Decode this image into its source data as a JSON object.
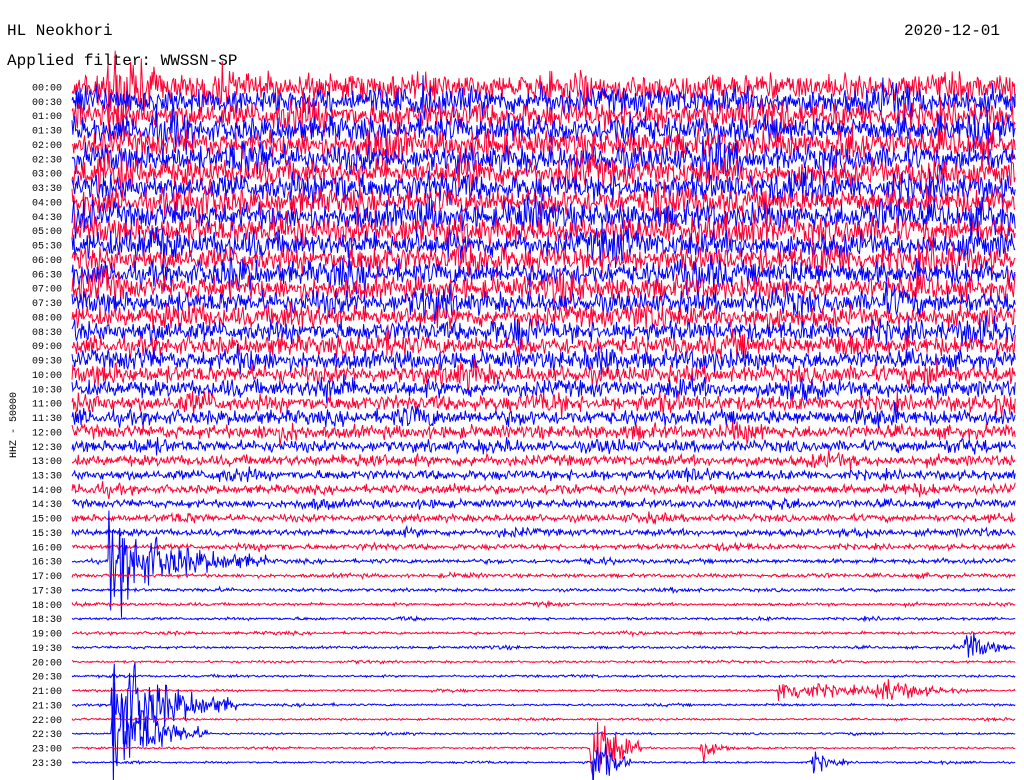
{
  "header": {
    "station": "HL Neokhori",
    "date": "2020-12-01",
    "filter": "Applied filter: WWSSN-SP"
  },
  "chart_data": {
    "type": "line",
    "title": "HL Neokhori",
    "date": "2020-12-01",
    "filter_label": "Applied filter: WWSSN-SP",
    "ylabel": "HHZ - 50000",
    "row_labels": [
      "00:00",
      "00:30",
      "01:00",
      "01:30",
      "02:00",
      "02:30",
      "03:00",
      "03:30",
      "04:00",
      "04:30",
      "05:00",
      "05:30",
      "06:00",
      "06:30",
      "07:00",
      "07:30",
      "08:00",
      "08:30",
      "09:00",
      "09:30",
      "10:00",
      "10:30",
      "11:00",
      "11:30",
      "12:00",
      "12:30",
      "13:00",
      "13:30",
      "14:00",
      "14:30",
      "15:00",
      "15:30",
      "16:00",
      "16:30",
      "17:00",
      "17:30",
      "18:00",
      "18:30",
      "19:00",
      "19:30",
      "20:00",
      "20:30",
      "21:00",
      "21:30",
      "22:00",
      "22:30",
      "23:00",
      "23:30"
    ],
    "row_colors": [
      "#ff0033",
      "#0000ff"
    ],
    "row_amplitudes": [
      3.0,
      3.0,
      3.0,
      3.0,
      3.0,
      3.0,
      3.0,
      3.0,
      3.0,
      3.0,
      3.0,
      2.9,
      2.8,
      2.7,
      2.6,
      2.5,
      2.4,
      2.3,
      2.2,
      2.1,
      2.0,
      1.9,
      1.8,
      1.7,
      1.5,
      1.3,
      1.2,
      1.1,
      1.0,
      0.9,
      0.8,
      0.75,
      0.6,
      0.5,
      0.4,
      0.35,
      0.32,
      0.3,
      0.3,
      0.28,
      0.25,
      0.25,
      0.25,
      0.25,
      0.22,
      0.22,
      0.22,
      0.22
    ],
    "events": [
      {
        "row": 0,
        "minute": 1.2,
        "amplitude": 18,
        "duration": 1.5
      },
      {
        "row": 33,
        "minute": 1.2,
        "amplitude": 10,
        "duration": 5
      },
      {
        "row": 43,
        "minute": 1.3,
        "amplitude": 14,
        "duration": 4
      },
      {
        "row": 45,
        "minute": 1.3,
        "amplitude": 12,
        "duration": 3
      },
      {
        "row": 46,
        "minute": 16.5,
        "amplitude": 12,
        "duration": 1.6
      },
      {
        "row": 47,
        "minute": 16.6,
        "amplitude": 8,
        "duration": 1.2
      },
      {
        "row": 39,
        "minute": 28.4,
        "amplitude": 4,
        "duration": 1.5
      },
      {
        "row": 42,
        "minute": 22.5,
        "amplitude": 3,
        "duration": 4
      },
      {
        "row": 42,
        "minute": 25.5,
        "amplitude": 3,
        "duration": 3
      },
      {
        "row": 46,
        "minute": 20.0,
        "amplitude": 3,
        "duration": 1
      },
      {
        "row": 47,
        "minute": 23.5,
        "amplitude": 3,
        "duration": 1.2
      }
    ]
  }
}
